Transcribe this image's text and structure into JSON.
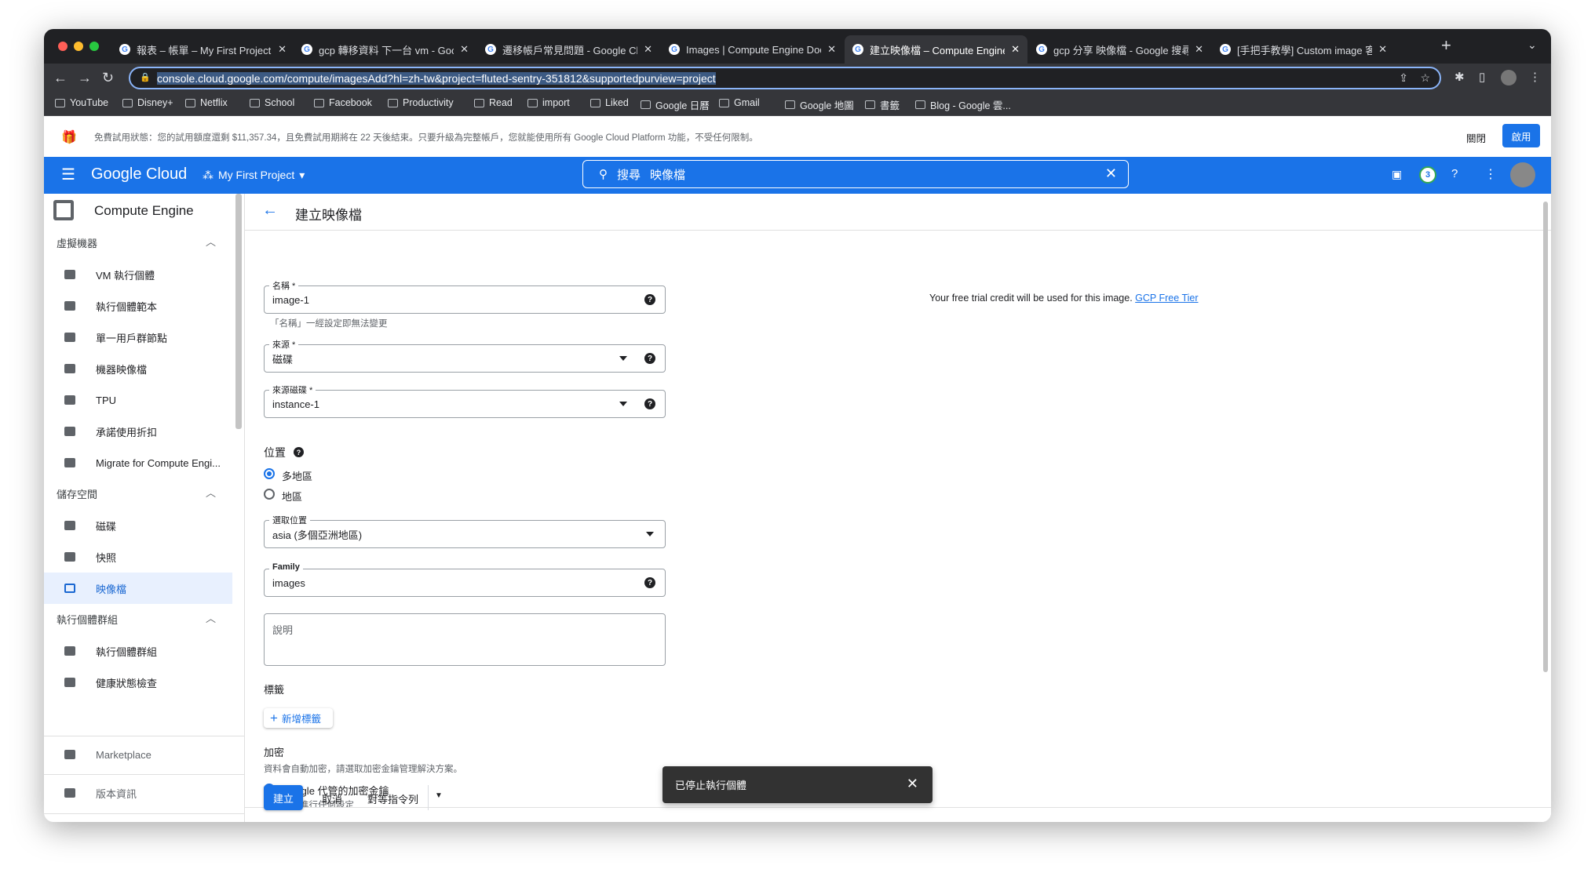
{
  "browser": {
    "tabs": [
      {
        "title": "報表 – 帳單 – My First Project –",
        "active": false
      },
      {
        "title": "gcp 轉移資料 下一台 vm - Goog",
        "active": false
      },
      {
        "title": "遷移帳戶常見問題 - Google Clo",
        "active": false
      },
      {
        "title": "Images | Compute Engine Doc",
        "active": false
      },
      {
        "title": "建立映像檔 – Compute Engine –",
        "active": true
      },
      {
        "title": "gcp 分享 映像檔 - Google 搜尋",
        "active": false
      },
      {
        "title": "[手把手教學] Custom image 客製",
        "active": false
      }
    ],
    "url": "console.cloud.google.com/compute/imagesAdd?hl=zh-tw&project=fluted-sentry-351812&supportedpurview=project",
    "bookmarks": [
      "YouTube",
      "Disney+",
      "Netflix",
      "School",
      "Facebook",
      "Productivity",
      "Read",
      "import",
      "Liked",
      "Google 日曆",
      "Gmail",
      "Google 地圖",
      "書籤",
      "Blog - Google 雲..."
    ]
  },
  "banner": {
    "text": "免費試用狀態：您的試用額度還剩 $11,357.34，且免費試用期將在 22 天後結束。只要升級為完整帳戶，您就能使用所有 Google Cloud Platform 功能，不受任何限制。",
    "dismiss": "關閉",
    "activate": "啟用"
  },
  "header": {
    "logo": "Google Cloud",
    "project": "My First Project",
    "search_label": "搜尋",
    "search_value": "映像檔",
    "notif_count": "3"
  },
  "sidebar": {
    "product": "Compute Engine",
    "sections": [
      {
        "title": "虛擬機器",
        "items": [
          "VM 執行個體",
          "執行個體範本",
          "單一用戶群節點",
          "機器映像檔",
          "TPU",
          "承諾使用折扣",
          "Migrate for Compute Engi..."
        ]
      },
      {
        "title": "儲存空間",
        "items": [
          "磁碟",
          "快照",
          "映像檔"
        ]
      },
      {
        "title": "執行個體群組",
        "items": [
          "執行個體群組",
          "健康狀態檢查"
        ]
      }
    ],
    "selected": "映像檔",
    "marketplace": "Marketplace",
    "release_notes": "版本資訊",
    "collapse": "<I"
  },
  "page": {
    "title": "建立映像檔",
    "name_label": "名稱 *",
    "name_value": "image-1",
    "name_hint": "「名稱」一經設定即無法變更",
    "source_label": "來源 *",
    "source_value": "磁碟",
    "source_disk_label": "來源磁碟 *",
    "source_disk_value": "instance-1",
    "location_title": "位置",
    "loc_multi": "多地區",
    "loc_region": "地區",
    "select_loc_label": "選取位置",
    "select_loc_value": "asia (多個亞洲地區)",
    "family_label": "Family",
    "family_value": "images",
    "desc_placeholder": "說明",
    "labels_title": "標籤",
    "add_label": "新增標籤",
    "enc_title": "加密",
    "enc_desc": "資料會自動加密，請選取加密金鑰管理解決方案。",
    "enc_google": "Google 代管的加密金鑰",
    "enc_google_sub": "無須進行任何設定",
    "trial_note": "Your free trial credit will be used for this image.",
    "trial_link": "GCP Free Tier",
    "create": "建立",
    "cancel": "取消",
    "equiv": "對等指令列"
  },
  "toast": {
    "text": "已停止執行個體"
  },
  "colors": {
    "brand_blue": "#1a73e8",
    "selected_bg": "#e8f0fe"
  }
}
